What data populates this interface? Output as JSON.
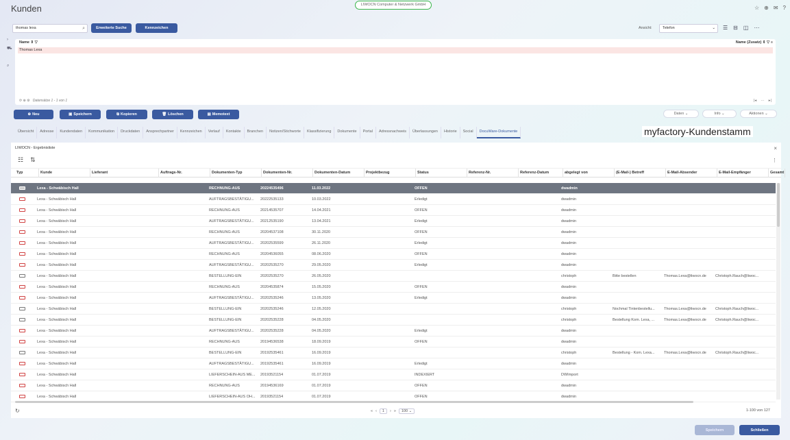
{
  "window": {
    "title": "Kunden",
    "company": "LIWOCN Computer & Netzwerk GmbH"
  },
  "toolbar": {
    "search_value": "thomas lexa",
    "adv_search": "Erweiterte Suche",
    "kennzeichen": "Kennzeichen",
    "ansicht_label": "Ansicht:",
    "ansicht_value": "Telefon"
  },
  "panel": {
    "col_name": "Name",
    "col_name2": "Name (Zusatz)",
    "row": "Thomas Lexa",
    "footer": "Datensätze 1 - 1 von 1"
  },
  "actions": {
    "neu": "Neu",
    "speichern": "Speichern",
    "kopieren": "Kopieren",
    "loeschen": "Löschen",
    "memotext": "Memotext",
    "daten": "Daten",
    "info": "Info",
    "aktionen": "Aktionen"
  },
  "tabs": [
    "Übersicht",
    "Adresse",
    "Kundendaten",
    "Kommunikation",
    "Druckdaten",
    "Ansprechpartner",
    "Kennzeichen",
    "Verlauf",
    "Kontakte",
    "Branchen",
    "Notizen/Stichworte",
    "Klassifizierung",
    "Dokumente",
    "Portal",
    "Adressnachweis",
    "Überlassungen",
    "Historie",
    "Social",
    "DocuWare-Dokumente"
  ],
  "caption": "myfactory-Kundenstamm",
  "resultlist": {
    "title": "LIWOCN - Ergebnisliste",
    "columns": [
      "Typ",
      "Kunde",
      "Lieferant",
      "Auftrags-Nr.",
      "Dokumenten-Typ",
      "Dokumenten-Nr.",
      "Dokumenten-Datum",
      "Projektbezug",
      "Status",
      "Referenz-Nr.",
      "Referenz-Datum",
      "abgelegt von",
      "(E-Mail-) Betreff",
      "E-Mail-Absender",
      "E-Mail-Empfänger",
      "Gesamt"
    ],
    "rows": [
      {
        "typ": "mail",
        "kunde": "Lexa - Schwäbisch Hall",
        "dtyp": "RECHNUNG-AUS",
        "dnr": "20224535496",
        "datum": "11.03.2022",
        "status": "OFFEN",
        "von": "dwadmin",
        "betreff": "",
        "abs": "",
        "emp": ""
      },
      {
        "typ": "pdf",
        "kunde": "Lexa - Schwäbisch Hall",
        "dtyp": "AUFTRAGSBESTÄTIGU...",
        "dnr": "20222535133",
        "datum": "10.03.2022",
        "status": "Erledigt",
        "von": "dwadmin",
        "betreff": "",
        "abs": "",
        "emp": ""
      },
      {
        "typ": "pdf",
        "kunde": "Lexa - Schwäbisch Hall",
        "dtyp": "RECHNUNG-AUS",
        "dnr": "20214535707",
        "datum": "14.04.2021",
        "status": "OFFEN",
        "von": "dwadmin",
        "betreff": "",
        "abs": "",
        "emp": ""
      },
      {
        "typ": "pdf",
        "kunde": "Lexa - Schwäbisch Hall",
        "dtyp": "AUFTRAGSBESTÄTIGU...",
        "dnr": "20212535190",
        "datum": "13.04.2021",
        "status": "Erledigt",
        "von": "dwadmin",
        "betreff": "",
        "abs": "",
        "emp": ""
      },
      {
        "typ": "pdf",
        "kunde": "Lexa - Schwäbisch Hall",
        "dtyp": "RECHNUNG-AUS",
        "dnr": "20204537108",
        "datum": "30.11.2020",
        "status": "OFFEN",
        "von": "dwadmin",
        "betreff": "",
        "abs": "",
        "emp": ""
      },
      {
        "typ": "pdf",
        "kunde": "Lexa - Schwäbisch Hall",
        "dtyp": "AUFTRAGSBESTÄTIGU...",
        "dnr": "20202535599",
        "datum": "26.11.2020",
        "status": "Erledigt",
        "von": "dwadmin",
        "betreff": "",
        "abs": "",
        "emp": ""
      },
      {
        "typ": "pdf",
        "kunde": "Lexa - Schwäbisch Hall",
        "dtyp": "RECHNUNG-AUS",
        "dnr": "20204536055",
        "datum": "08.06.2020",
        "status": "OFFEN",
        "von": "dwadmin",
        "betreff": "",
        "abs": "",
        "emp": ""
      },
      {
        "typ": "pdf",
        "kunde": "Lexa - Schwäbisch Hall",
        "dtyp": "AUFTRAGSBESTÄTIGU...",
        "dnr": "20202535270",
        "datum": "29.05.2020",
        "status": "Erledigt",
        "von": "dwadmin",
        "betreff": "",
        "abs": "",
        "emp": ""
      },
      {
        "typ": "mail",
        "kunde": "Lexa - Schwäbisch Hall",
        "dtyp": "BESTELLUNG-EIN",
        "dnr": "20202535270",
        "datum": "26.05.2020",
        "status": "",
        "von": "christoph",
        "betreff": "Bitte bestellen",
        "abs": "Thomas.Lexa@liwocn.de",
        "emp": "Christoph.Rauch@liwoc..."
      },
      {
        "typ": "pdf",
        "kunde": "Lexa - Schwäbisch Hall",
        "dtyp": "RECHNUNG-AUS",
        "dnr": "20204535874",
        "datum": "15.05.2020",
        "status": "OFFEN",
        "von": "dwadmin",
        "betreff": "",
        "abs": "",
        "emp": ""
      },
      {
        "typ": "pdf",
        "kunde": "Lexa - Schwäbisch Hall",
        "dtyp": "AUFTRAGSBESTÄTIGU...",
        "dnr": "20202535246",
        "datum": "13.05.2020",
        "status": "Erledigt",
        "von": "dwadmin",
        "betreff": "",
        "abs": "",
        "emp": ""
      },
      {
        "typ": "mail",
        "kunde": "Lexa - Schwäbisch Hall",
        "dtyp": "BESTELLUNG-EIN",
        "dnr": "20202535246",
        "datum": "12.05.2020",
        "status": "",
        "von": "christoph",
        "betreff": "Nochmal Tintenbestellu...",
        "abs": "Thomas.Lexa@liwocn.de",
        "emp": "Christoph.Rauch@liwoc..."
      },
      {
        "typ": "mail",
        "kunde": "Lexa - Schwäbisch Hall",
        "dtyp": "BESTELLUNG-EIN",
        "dnr": "20202535228",
        "datum": "04.05.2020",
        "status": "",
        "von": "christoph",
        "betreff": "Bestellung Kom. Lexa, ...",
        "abs": "Thomas.Lexa@liwocn.de",
        "emp": "Christoph.Rauch@liwoc..."
      },
      {
        "typ": "pdf",
        "kunde": "Lexa - Schwäbisch Hall",
        "dtyp": "AUFTRAGSBESTÄTIGU...",
        "dnr": "20202535228",
        "datum": "04.05.2020",
        "status": "Erledigt",
        "von": "dwadmin",
        "betreff": "",
        "abs": "",
        "emp": ""
      },
      {
        "typ": "pdf",
        "kunde": "Lexa - Schwäbisch Hall",
        "dtyp": "RECHNUNG-AUS",
        "dnr": "20194536538",
        "datum": "18.09.2019",
        "status": "OFFEN",
        "von": "dwadmin",
        "betreff": "",
        "abs": "",
        "emp": ""
      },
      {
        "typ": "mail",
        "kunde": "Lexa - Schwäbisch Hall",
        "dtyp": "BESTELLUNG-EIN",
        "dnr": "20192535461",
        "datum": "16.09.2019",
        "status": "",
        "von": "christoph",
        "betreff": "Bestellung - Kom. Lexa...",
        "abs": "Thomas.Lexa@liwocn.de",
        "emp": "Christoph.Rauch@liwoc..."
      },
      {
        "typ": "pdf",
        "kunde": "Lexa - Schwäbisch Hall",
        "dtyp": "AUFTRAGSBESTÄTIGU...",
        "dnr": "20192535461",
        "datum": "16.09.2019",
        "status": "Erledigt",
        "von": "dwadmin",
        "betreff": "",
        "abs": "",
        "emp": ""
      },
      {
        "typ": "pdf",
        "kunde": "Lexa - Schwäbisch Hall",
        "dtyp": "LIEFERSCHEIN-AUS ME...",
        "dnr": "20193521154",
        "datum": "01.07.2019",
        "status": "INDEXIERT",
        "von": "DWImport",
        "betreff": "",
        "abs": "",
        "emp": ""
      },
      {
        "typ": "pdf",
        "kunde": "Lexa - Schwäbisch Hall",
        "dtyp": "RECHNUNG-AUS",
        "dnr": "20194536169",
        "datum": "01.07.2019",
        "status": "OFFEN",
        "von": "dwadmin",
        "betreff": "",
        "abs": "",
        "emp": ""
      },
      {
        "typ": "pdf",
        "kunde": "Lexa - Schwäbisch Hall",
        "dtyp": "LIEFERSCHEIN-AUS OH...",
        "dnr": "20193521154",
        "datum": "01.07.2019",
        "status": "OFFEN",
        "von": "dwadmin",
        "betreff": "",
        "abs": "",
        "emp": ""
      }
    ],
    "page": "1",
    "pagesize": "100",
    "count": "1-100 von 127"
  },
  "footer": {
    "speichern": "Speichern",
    "schliessen": "Schließen"
  }
}
